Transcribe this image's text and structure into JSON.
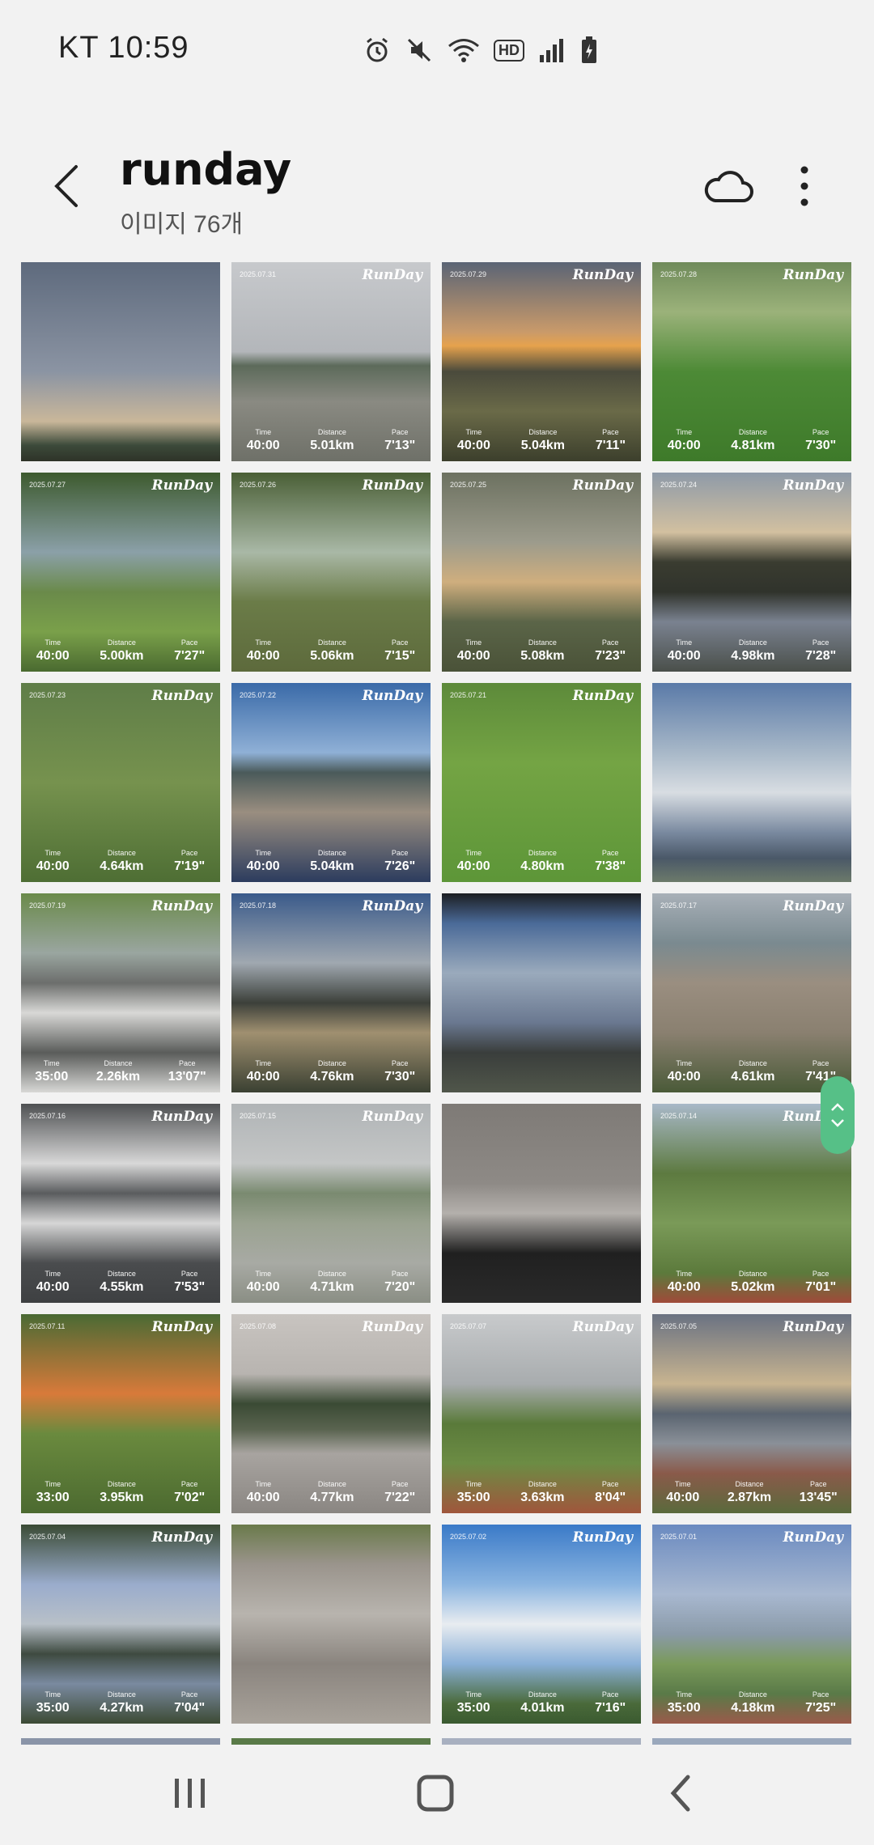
{
  "status_bar": {
    "carrier_time": "KT 10:59",
    "icons": [
      "alarm-icon",
      "mute-icon",
      "wifi-icon",
      "hd-icon",
      "signal-icon",
      "battery-icon"
    ],
    "hd_label": "HD"
  },
  "header": {
    "title": "runday",
    "subtitle": "이미지 76개",
    "back_icon": "chevron-left-icon",
    "cloud_icon": "cloud-icon",
    "more_icon": "more-vertical-icon"
  },
  "labels": {
    "time": "Time",
    "distance": "Distance",
    "pace": "Pace",
    "logo": "RunDay"
  },
  "photos": [
    {
      "date": "",
      "time": "",
      "distance": "",
      "pace": "",
      "stamp": false,
      "bg": "linear-gradient(180deg,#5e6a7d 0%,#8b94a3 55%,#c9b79a 80%,#3c4a3a 92%,#2e3328 100%)"
    },
    {
      "date": "2025.07.31",
      "time": "40:00",
      "distance": "5.01km",
      "pace": "7'13\"",
      "stamp": true,
      "bg": "linear-gradient(180deg,#c7c9cc 0%,#b3b6ba 45%,#5c6a5a 52%,#8a8a82 70%,#6e7068 100%)"
    },
    {
      "date": "2025.07.29",
      "time": "40:00",
      "distance": "5.04km",
      "pace": "7'11\"",
      "stamp": true,
      "bg": "linear-gradient(180deg,#5a6475 0%,#c99a6a 35%,#e6a24d 42%,#4a4a3c 55%,#6a6a48 75%,#3c3f2c 100%)"
    },
    {
      "date": "2025.07.28",
      "time": "40:00",
      "distance": "4.81km",
      "pace": "7'30\"",
      "stamp": true,
      "bg": "linear-gradient(180deg,#6f8a5a 0%,#9bb27a 25%,#4d8a36 55%,#3e7a2a 100%)"
    },
    {
      "date": "2025.07.27",
      "time": "40:00",
      "distance": "5.00km",
      "pace": "7'27\"",
      "stamp": true,
      "bg": "linear-gradient(180deg,#3d5a2e 0%,#8ba0a8 40%,#6a8a4a 60%,#7aa04a 80%,#4a6a30 100%)"
    },
    {
      "date": "2025.07.26",
      "time": "40:00",
      "distance": "5.06km",
      "pace": "7'15\"",
      "stamp": true,
      "bg": "linear-gradient(180deg,#4a5f36 0%,#a9b8a6 40%,#6b7c48 65%,#5d6a3c 100%)"
    },
    {
      "date": "2025.07.25",
      "time": "40:00",
      "distance": "5.08km",
      "pace": "7'23\"",
      "stamp": true,
      "bg": "linear-gradient(180deg,#6c7160 0%,#9c9b8c 35%,#cfae7e 55%,#5b6548 75%,#4a5238 100%)"
    },
    {
      "date": "2025.07.24",
      "time": "40:00",
      "distance": "4.98km",
      "pace": "7'28\"",
      "stamp": true,
      "bg": "linear-gradient(180deg,#8e9aa8 0%,#d2c0a0 30%,#3a3c30 45%,#30332c 60%,#7a8290 75%,#4a4f4a 100%)"
    },
    {
      "date": "2025.07.23",
      "time": "40:00",
      "distance": "4.64km",
      "pace": "7'19\"",
      "stamp": true,
      "bg": "linear-gradient(180deg,#5f7d48 0%,#76924e 50%,#4e6e34 100%)"
    },
    {
      "date": "2025.07.22",
      "time": "40:00",
      "distance": "5.04km",
      "pace": "7'26\"",
      "stamp": true,
      "bg": "linear-gradient(180deg,#3a6aa8 0%,#8fb0d6 35%,#4a5a5a 45%,#9a8e80 65%,#2c3c5e 100%)"
    },
    {
      "date": "2025.07.21",
      "time": "40:00",
      "distance": "4.80km",
      "pace": "7'38\"",
      "stamp": true,
      "bg": "linear-gradient(180deg,#5d8a3a 0%,#74a444 40%,#5d9638 100%)"
    },
    {
      "date": "",
      "time": "",
      "distance": "",
      "pace": "",
      "stamp": false,
      "bg": "linear-gradient(180deg,#5a7aa8 0%,#a8b8c8 35%,#d8dde2 55%,#7a8aa0 75%,#4a5868 88%,#6c7a6a 100%)"
    },
    {
      "date": "2025.07.19",
      "time": "35:00",
      "distance": "2.26km",
      "pace": "13'07\"",
      "stamp": true,
      "bg": "linear-gradient(180deg,#6a8a4a 0%,#9aa6a0 30%,#6c6e6c 45%,#d8d8d6 60%,#5a5c5a 80%,#d8d8d6 100%)"
    },
    {
      "date": "2025.07.18",
      "time": "40:00",
      "distance": "4.76km",
      "pace": "7'30\"",
      "stamp": true,
      "bg": "linear-gradient(180deg,#3a5a8a 0%,#a0a8b0 35%,#3c403a 55%,#a09070 70%,#3a4032 100%)"
    },
    {
      "date": "",
      "time": "",
      "distance": "",
      "pace": "",
      "stamp": false,
      "bg": "linear-gradient(180deg,#1c1e22 0%,#4a6a98 15%,#9aaabc 40%,#6a7890 65%,#3a3e3c 80%,#50564a 100%)"
    },
    {
      "date": "2025.07.17",
      "time": "40:00",
      "distance": "4.61km",
      "pace": "7'41\"",
      "stamp": true,
      "bg": "linear-gradient(180deg,#a8b0b8 0%,#7a8a90 25%,#9a8e80 45%,#8a8070 70%,#4a5a38 100%)"
    },
    {
      "date": "2025.07.16",
      "time": "40:00",
      "distance": "4.55km",
      "pace": "7'53\"",
      "stamp": true,
      "bg": "linear-gradient(180deg,#4e5052 0%,#d8d8d8 30%,#5a5c5e 45%,#d6d6d6 60%,#4a4c4e 80%,#3e4042 100%)"
    },
    {
      "date": "2025.07.15",
      "time": "40:00",
      "distance": "4.71km",
      "pace": "7'20\"",
      "stamp": true,
      "bg": "linear-gradient(180deg,#b0b4b6 0%,#c4c6c6 30%,#7a8a70 45%,#9aa290 60%,#a8aaa4 80%,#8a8e84 100%)"
    },
    {
      "date": "",
      "time": "",
      "distance": "",
      "pace": "",
      "stamp": false,
      "bg": "linear-gradient(180deg,#7e7a76 0%,#8e8a86 40%,#b4b0ac 55%,#202020 75%,#2a2a2a 100%)"
    },
    {
      "date": "2025.07.14",
      "time": "40:00",
      "distance": "5.02km",
      "pace": "7'01\"",
      "stamp": true,
      "bg": "linear-gradient(180deg,#a8b8c8 0%,#5d7a40 35%,#7a9a58 60%,#5c7a3c 85%,#a04a3a 100%)"
    },
    {
      "date": "2025.07.11",
      "time": "33:00",
      "distance": "3.95km",
      "pace": "7'02\"",
      "stamp": true,
      "bg": "linear-gradient(180deg,#4a6a34 0%,#d87a3a 40%,#6a8a3e 60%,#4c6a30 100%)"
    },
    {
      "date": "2025.07.08",
      "time": "40:00",
      "distance": "4.77km",
      "pace": "7'22\"",
      "stamp": true,
      "bg": "linear-gradient(180deg,#c8c4c0 0%,#b8b4b0 30%,#3a4a34 45%,#5a6450 58%,#a8a4a0 70%,#8a8682 100%)"
    },
    {
      "date": "2025.07.07",
      "time": "35:00",
      "distance": "3.63km",
      "pace": "8'04\"",
      "stamp": true,
      "bg": "linear-gradient(180deg,#c8cacc 0%,#a8acae 35%,#5a7a3a 55%,#6c8c44 75%,#a0563c 100%)"
    },
    {
      "date": "2025.07.05",
      "time": "40:00",
      "distance": "2.87km",
      "pace": "13'45\"",
      "stamp": true,
      "bg": "linear-gradient(180deg,#6a7282 0%,#c8b490 35%,#5a6470 50%,#8a9098 65%,#8a5a4a 80%,#5a6a3c 100%)"
    },
    {
      "date": "2025.07.04",
      "time": "35:00",
      "distance": "4.27km",
      "pace": "7'04\"",
      "stamp": true,
      "bg": "linear-gradient(180deg,#3a4a34 0%,#9aaccc 30%,#b8c0c8 50%,#3e4a40 65%,#7a8aa0 80%,#3c4a34 100%)"
    },
    {
      "date": "",
      "time": "",
      "distance": "",
      "pace": "",
      "stamp": false,
      "bg": "linear-gradient(180deg,#6a7a4a 0%,#9a948c 20%,#b8b4ae 45%,#8a847e 70%,#a8a29a 100%)"
    },
    {
      "date": "2025.07.02",
      "time": "35:00",
      "distance": "4.01km",
      "pace": "7'16\"",
      "stamp": true,
      "bg": "linear-gradient(180deg,#3a7ac8 0%,#8ab4e0 30%,#e8ecf0 50%,#8ab0d8 70%,#4a6a3a 90%,#3a5a30 100%)"
    },
    {
      "date": "2025.07.01",
      "time": "35:00",
      "distance": "4.18km",
      "pace": "7'25\"",
      "stamp": true,
      "bg": "linear-gradient(180deg,#6a8ac0 0%,#a8b8d0 35%,#8a9aa8 55%,#7a9a5a 70%,#5a7a48 85%,#9a5a4a 100%)"
    }
  ],
  "partial_row_colors": [
    "#8a94a8",
    "#5a7a48",
    "#a8b0c0",
    "#9aa8bc"
  ],
  "navbar": {
    "recents_icon": "recents-icon",
    "home_icon": "home-icon",
    "back_icon": "back-icon"
  },
  "colors": {
    "accent": "#56c087",
    "background": "#f2f2f2"
  }
}
